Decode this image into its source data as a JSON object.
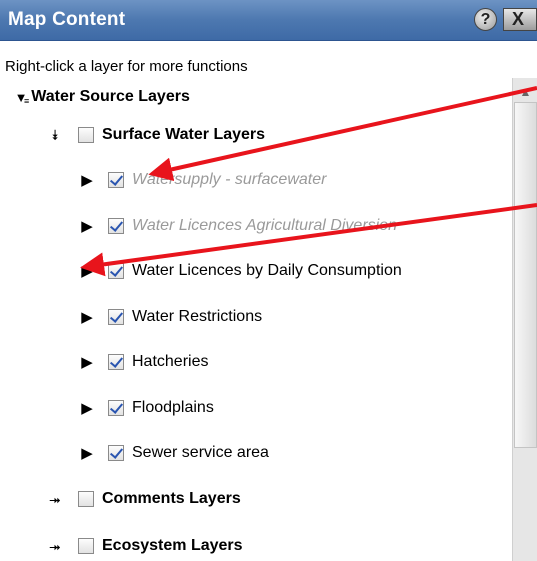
{
  "panel": {
    "title": "Map Content",
    "help_glyph": "?",
    "close_glyph": "X",
    "hint": "Right-click a layer for more functions"
  },
  "tree": {
    "root": {
      "label": "Water Source Layers",
      "expanded": true
    },
    "groups": [
      {
        "label": "Surface Water Layers",
        "expanded": true,
        "checked": false,
        "layers": [
          {
            "label": "Watersupply - surfacewater",
            "checked": true,
            "dimmed": true
          },
          {
            "label": "Water Licences Agricultural Diversion",
            "checked": true,
            "dimmed": true
          },
          {
            "label": "Water Licences by Daily Consumption",
            "checked": true,
            "dimmed": false
          },
          {
            "label": "Water Restrictions",
            "checked": true,
            "dimmed": false
          },
          {
            "label": "Hatcheries",
            "checked": true,
            "dimmed": false
          },
          {
            "label": "Floodplains",
            "checked": true,
            "dimmed": false
          },
          {
            "label": "Sewer service area",
            "checked": true,
            "dimmed": false
          }
        ]
      },
      {
        "label": "Comments Layers",
        "expanded": false,
        "checked": false
      },
      {
        "label": "Ecosystem Layers",
        "expanded": false,
        "checked": false
      }
    ]
  },
  "annotation": {
    "arrow_color": "#e8141c"
  },
  "colors": {
    "titlebar": "#4d78b0",
    "check": "#2a55b0",
    "dimmed_text": "#9a9a9a"
  }
}
